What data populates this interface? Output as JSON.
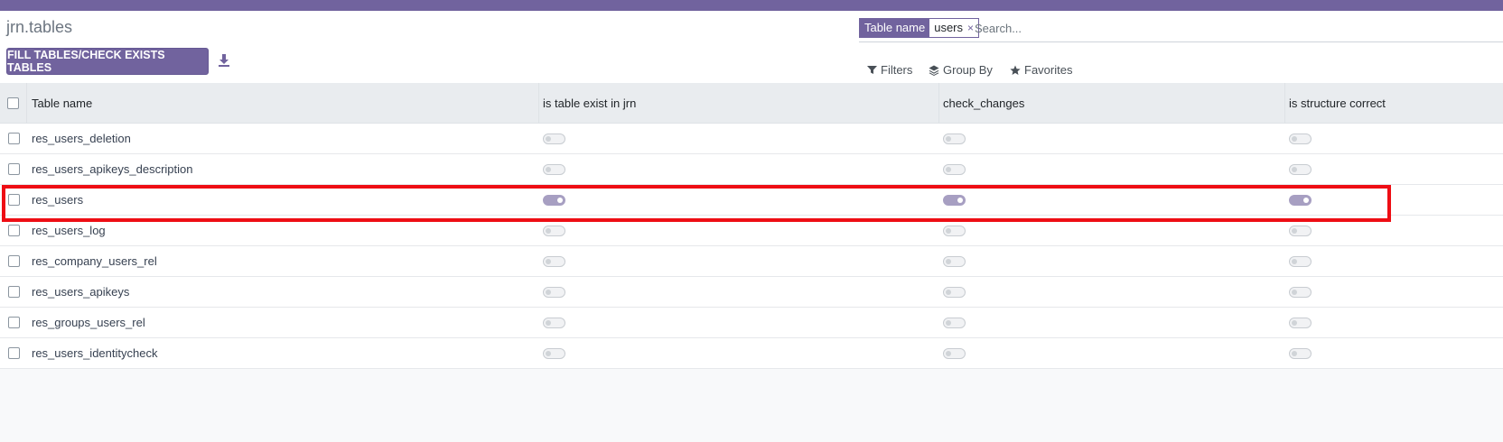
{
  "page": {
    "breadcrumb": "jrn.tables",
    "fill_button_label": "FILL TABLES/CHECK EXISTS TABLES",
    "download_icon": "download-icon"
  },
  "search": {
    "facet_label": "Table name",
    "facet_value": "users",
    "facet_close": "×",
    "placeholder": "Search..."
  },
  "filters": {
    "filters_label": "Filters",
    "groupby_label": "Group By",
    "favorites_label": "Favorites"
  },
  "list": {
    "columns": [
      "Table name",
      "is table exist in jrn",
      "check_changes",
      "is structure correct"
    ],
    "rows": [
      {
        "name": "res_users_deletion",
        "exist": false,
        "changes": false,
        "correct": false
      },
      {
        "name": "res_users_apikeys_description",
        "exist": false,
        "changes": false,
        "correct": false
      },
      {
        "name": "res_users",
        "exist": true,
        "changes": true,
        "correct": true
      },
      {
        "name": "res_users_log",
        "exist": false,
        "changes": false,
        "correct": false
      },
      {
        "name": "res_company_users_rel",
        "exist": false,
        "changes": false,
        "correct": false
      },
      {
        "name": "res_users_apikeys",
        "exist": false,
        "changes": false,
        "correct": false
      },
      {
        "name": "res_groups_users_rel",
        "exist": false,
        "changes": false,
        "correct": false
      },
      {
        "name": "res_users_identitycheck",
        "exist": false,
        "changes": false,
        "correct": false
      }
    ]
  },
  "colors": {
    "accent": "#71639e",
    "toggle_on": "#a79fc2",
    "highlight_border": "#ee0d14"
  }
}
